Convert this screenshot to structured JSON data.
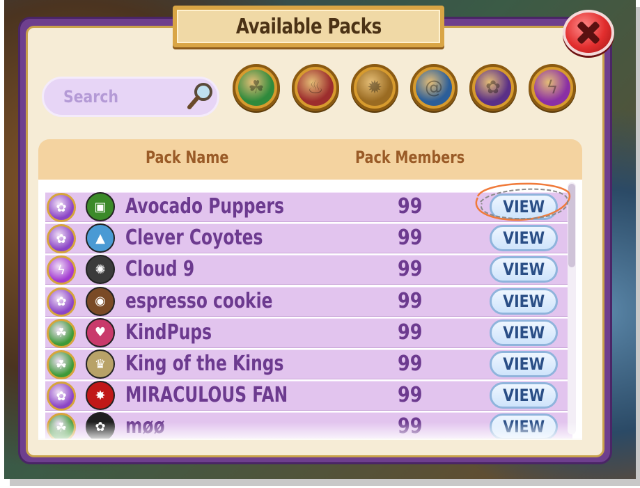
{
  "dialog": {
    "title": "Available Packs",
    "close_label": "close"
  },
  "search": {
    "placeholder": "Search"
  },
  "filters": [
    {
      "name": "nature",
      "color": "#2f8a3c",
      "glyph": "☘"
    },
    {
      "name": "fire",
      "color": "#9c2d2d",
      "glyph": "♨"
    },
    {
      "name": "gear",
      "color": "#9a6b22",
      "glyph": "✹"
    },
    {
      "name": "water",
      "color": "#2b5e99",
      "glyph": "@"
    },
    {
      "name": "flower",
      "color": "#5a2f87",
      "glyph": "✿"
    },
    {
      "name": "lightning",
      "color": "#8a2fa5",
      "glyph": "ϟ"
    }
  ],
  "table": {
    "headers": {
      "name": "Pack Name",
      "members": "Pack Members"
    },
    "view_label": "VIEW",
    "rows": [
      {
        "name": "Avocado Puppers",
        "members": "99",
        "badge_color": "#8b45c6",
        "badge_glyph": "✿",
        "emblem_color": "#3c8a2a",
        "emblem_glyph": "▣"
      },
      {
        "name": "Clever Coyotes",
        "members": "99",
        "badge_color": "#8b45c6",
        "badge_glyph": "✿",
        "emblem_color": "#4a9ad4",
        "emblem_glyph": "▲"
      },
      {
        "name": "Cloud 9",
        "members": "99",
        "badge_color": "#a23ad0",
        "badge_glyph": "ϟ",
        "emblem_color": "#3b3b3b",
        "emblem_glyph": "✺"
      },
      {
        "name": "espresso cookie",
        "members": "99",
        "badge_color": "#8b45c6",
        "badge_glyph": "✿",
        "emblem_color": "#7a4a26",
        "emblem_glyph": "◉"
      },
      {
        "name": "KindPups",
        "members": "99",
        "badge_color": "#3e9a38",
        "badge_glyph": "☘",
        "emblem_color": "#c93a6b",
        "emblem_glyph": "♥"
      },
      {
        "name": "King of the Kings",
        "members": "99",
        "badge_color": "#3e9a38",
        "badge_glyph": "☘",
        "emblem_color": "#b8a268",
        "emblem_glyph": "♛"
      },
      {
        "name": "MIRACULOUS FAN",
        "members": "99",
        "badge_color": "#8b45c6",
        "badge_glyph": "✿",
        "emblem_color": "#c01818",
        "emblem_glyph": "✸"
      },
      {
        "name": "møø",
        "members": "99",
        "badge_color": "#3e9a38",
        "badge_glyph": "☘",
        "emblem_color": "#1f1f1f",
        "emblem_glyph": "✿"
      }
    ]
  }
}
